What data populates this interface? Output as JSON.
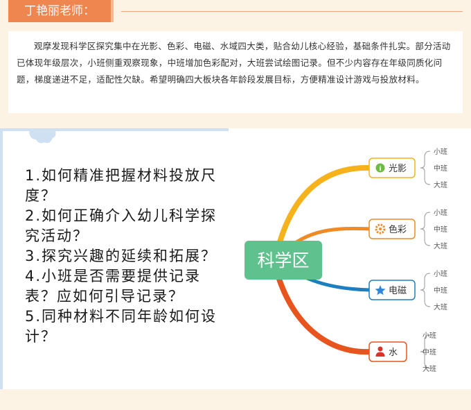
{
  "header": {
    "title": "丁艳丽老师："
  },
  "intro": {
    "text": "观摩发现科学区探究集中在光影、色彩、电磁、水域四大类，贴合幼儿核心经验，基础条件扎实。部分活动已体现年级层次，小班侧重观察现象，中班增加色彩配对，大班尝试绘图记录。但不少内容存在年级同质化问题，梯度递进不足，适配性欠缺。希望明确四大板块各年龄段发展目标，方便精准设计游戏与投放材料。"
  },
  "questions": [
    "1.如何精准把握材料投放尺度？",
    "2.如何正确介入幼儿科学探究活动？",
    "3.探究兴趣的延续和拓展？",
    "4.小班是否需要提供记录表？应如何引导记录？",
    "5.同种材料不同年龄如何设计？"
  ],
  "mindmap": {
    "center": "科学区",
    "branches": [
      {
        "label": "光影",
        "icon": "info-icon",
        "color": "#f6b21b",
        "levels": [
          "小班",
          "中班",
          "大班"
        ]
      },
      {
        "label": "色彩",
        "icon": "gear-icon",
        "color": "#f08a24",
        "levels": [
          "小班",
          "中班",
          "大班"
        ]
      },
      {
        "label": "电磁",
        "icon": "star-icon",
        "color": "#1e7fc0",
        "levels": [
          "小班",
          "中班",
          "大班"
        ]
      },
      {
        "label": "水",
        "icon": "person-icon",
        "color": "#e8541e",
        "levels": [
          "小班",
          "中班",
          "大班"
        ]
      }
    ]
  },
  "colors": {
    "accent": "#f0864f",
    "center": "#5fc28e",
    "page_bg": "#fdf3e4"
  }
}
